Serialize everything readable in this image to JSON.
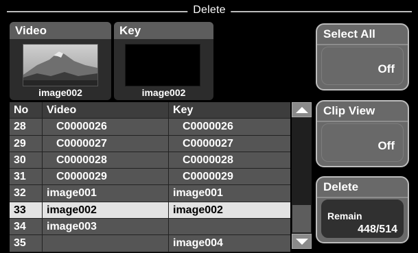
{
  "title": "Delete",
  "thumbs": {
    "video": {
      "label": "Video",
      "caption": "image002"
    },
    "key": {
      "label": "Key",
      "caption": "image002"
    }
  },
  "table": {
    "headers": {
      "no": "No",
      "video": "Video",
      "key": "Key"
    },
    "rows": [
      {
        "no": "28",
        "video": "C0000026",
        "key": "C0000026"
      },
      {
        "no": "29",
        "video": "C0000027",
        "key": "C0000027"
      },
      {
        "no": "30",
        "video": "C0000028",
        "key": "C0000028"
      },
      {
        "no": "31",
        "video": "C0000029",
        "key": "C0000029"
      },
      {
        "no": "32",
        "video": "image001",
        "key": "image001"
      },
      {
        "no": "33",
        "video": "image002",
        "key": "image002"
      },
      {
        "no": "34",
        "video": "image003",
        "key": ""
      },
      {
        "no": "35",
        "video": "",
        "key": "image004"
      }
    ]
  },
  "buttons": {
    "select_all": {
      "label": "Select All",
      "value": "Off"
    },
    "clip_view": {
      "label": "Clip View",
      "value": "Off"
    },
    "delete": {
      "label": "Delete",
      "remain_label": "Remain",
      "remain_value": "448/514"
    }
  }
}
